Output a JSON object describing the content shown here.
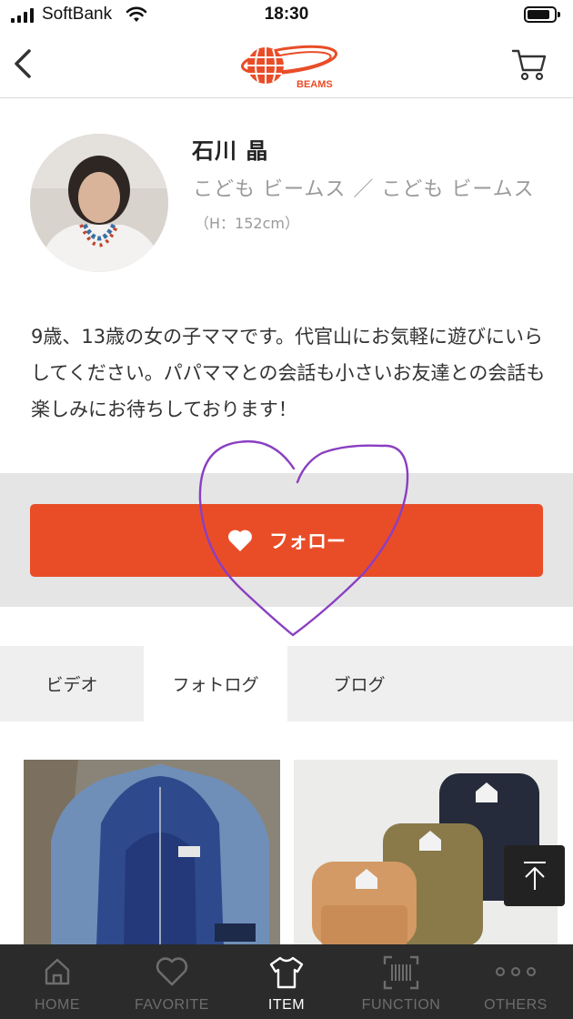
{
  "status_bar": {
    "carrier": "SoftBank",
    "time": "18:30"
  },
  "header": {
    "logo_text": "BEAMS",
    "logo_color": "#e94d28"
  },
  "profile": {
    "name": "石川 晶",
    "shop": "こども ビームス ／ こども ビームス",
    "height": "（H：152cm）",
    "bio": "9歳、13歳の女の子ママです。代官山にお気軽に遊びにいらしてください。パパママとの会話も小さいお友達との会話も楽しみにお待ちしております！"
  },
  "follow": {
    "label": "フォロー",
    "color": "#e94d28"
  },
  "tabs": [
    {
      "label": "ビデオ",
      "active": false
    },
    {
      "label": "フォトログ",
      "active": true
    },
    {
      "label": "ブログ",
      "active": false
    }
  ],
  "bottom_nav": [
    {
      "label": "HOME",
      "icon": "home-icon",
      "active": false
    },
    {
      "label": "FAVORITE",
      "icon": "heart-icon",
      "active": false
    },
    {
      "label": "ITEM",
      "icon": "tshirt-icon",
      "active": true
    },
    {
      "label": "FUNCTION",
      "icon": "barcode-icon",
      "active": false
    },
    {
      "label": "OTHERS",
      "icon": "more-icon",
      "active": false
    }
  ]
}
